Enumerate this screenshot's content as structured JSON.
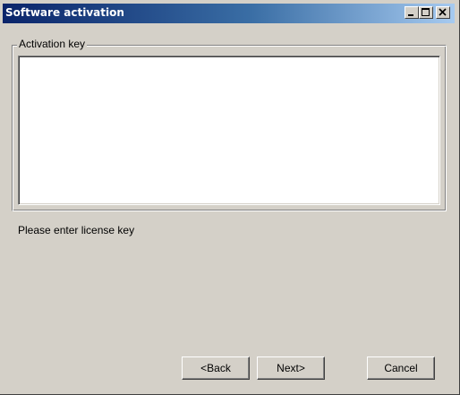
{
  "window": {
    "title": "Software activation"
  },
  "activation": {
    "group_label": "Activation key",
    "key_value": ""
  },
  "status": {
    "message": "Please enter license key"
  },
  "buttons": {
    "back": "<Back",
    "next": "Next>",
    "cancel": "Cancel"
  },
  "icons": {
    "minimize": "minimize-icon",
    "maximize": "maximize-icon",
    "close": "close-icon"
  },
  "colors": {
    "title_start": "#0a246a",
    "title_end": "#a6caf0",
    "face": "#d4d0c8"
  }
}
